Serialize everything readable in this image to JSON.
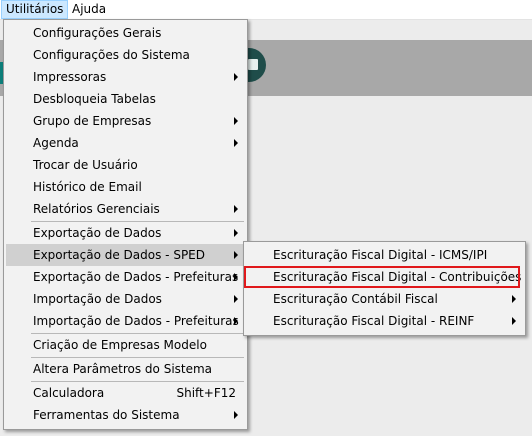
{
  "menubar": {
    "items": [
      {
        "label": "Utilitários"
      },
      {
        "label": "Ajuda"
      }
    ]
  },
  "main_menu": {
    "items": [
      {
        "label": "Configurações Gerais",
        "submenu": false
      },
      {
        "label": "Configurações do Sistema",
        "submenu": false
      },
      {
        "label": "Impressoras",
        "submenu": true
      },
      {
        "label": "Desbloqueia Tabelas",
        "submenu": false
      },
      {
        "label": "Grupo de Empresas",
        "submenu": true
      },
      {
        "label": "Agenda",
        "submenu": true
      },
      {
        "label": "Trocar de Usuário",
        "submenu": false
      },
      {
        "label": "Histórico de Email",
        "submenu": false
      },
      {
        "label": "Relatórios Gerenciais",
        "submenu": true
      },
      {
        "label": "Exportação de Dados",
        "submenu": true
      },
      {
        "label": "Exportação de Dados - SPED",
        "submenu": true,
        "highlighted": true
      },
      {
        "label": "Exportação de Dados - Prefeituras",
        "submenu": true
      },
      {
        "label": "Importação de Dados",
        "submenu": true
      },
      {
        "label": "Importação de Dados - Prefeituras",
        "submenu": true
      },
      {
        "label": "Criação de Empresas Modelo",
        "submenu": false
      },
      {
        "label": "Altera Parâmetros do Sistema",
        "submenu": false
      },
      {
        "label": "Calculadora",
        "shortcut": "Shift+F12",
        "submenu": false
      },
      {
        "label": "Ferramentas do Sistema",
        "submenu": true
      }
    ]
  },
  "sped_submenu": {
    "items": [
      {
        "label": "Escrituração Fiscal Digital - ICMS/IPI",
        "submenu": false
      },
      {
        "label": "Escrituração Fiscal Digital - Contribuições",
        "submenu": false,
        "outlined": true
      },
      {
        "label": "Escrituração Contábil Fiscal",
        "submenu": true
      },
      {
        "label": "Escrituração Fiscal Digital - REINF",
        "submenu": true
      }
    ]
  },
  "colors": {
    "menu_bg": "#f2f2f2",
    "highlight": "#d0d0d0",
    "menubar_active": "#cce8ff",
    "outline_red": "#e0181b",
    "app_strip": "#a8a8a8"
  }
}
